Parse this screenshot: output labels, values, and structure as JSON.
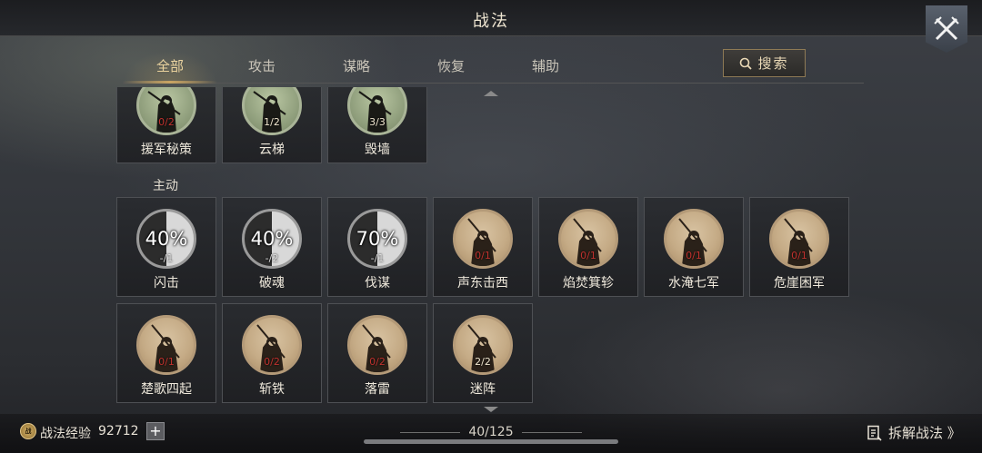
{
  "header": {
    "title": "战法"
  },
  "tabs": [
    {
      "label": "全部",
      "active": true
    },
    {
      "label": "攻击",
      "active": false
    },
    {
      "label": "谋略",
      "active": false
    },
    {
      "label": "恢复",
      "active": false
    },
    {
      "label": "辅助",
      "active": false
    }
  ],
  "search": {
    "label": "搜索"
  },
  "passive_row": [
    {
      "name": "援军秘策",
      "count": "0/2",
      "full": false
    },
    {
      "name": "云梯",
      "count": "1/2",
      "full": false
    },
    {
      "name": "毁墙",
      "count": "3/3",
      "full": true
    }
  ],
  "active_section": {
    "label": "主动"
  },
  "active_row1": [
    {
      "name": "闪击",
      "pct": "40%",
      "count": "-/1"
    },
    {
      "name": "破魂",
      "pct": "40%",
      "count": "-/2"
    },
    {
      "name": "伐谋",
      "pct": "70%",
      "count": "-/1"
    },
    {
      "name": "声东击西",
      "count": "0/1"
    },
    {
      "name": "焰焚箕轸",
      "count": "0/1"
    },
    {
      "name": "水淹七军",
      "count": "0/1"
    },
    {
      "name": "危崖困军",
      "count": "0/1"
    }
  ],
  "active_row2": [
    {
      "name": "楚歌四起",
      "count": "0/1",
      "full": false
    },
    {
      "name": "斩铁",
      "count": "0/2",
      "full": false
    },
    {
      "name": "落雷",
      "count": "0/2",
      "full": false
    },
    {
      "name": "迷阵",
      "count": "2/2",
      "full": true
    }
  ],
  "footer": {
    "exp_icon_text": "战",
    "exp_label": "战法经验",
    "exp_value": "92712",
    "plus": "+",
    "page": "40/125",
    "dismantle": "拆解战法 》"
  },
  "colors": {
    "accent": "#c9a463",
    "count_red": "#c0322e"
  }
}
